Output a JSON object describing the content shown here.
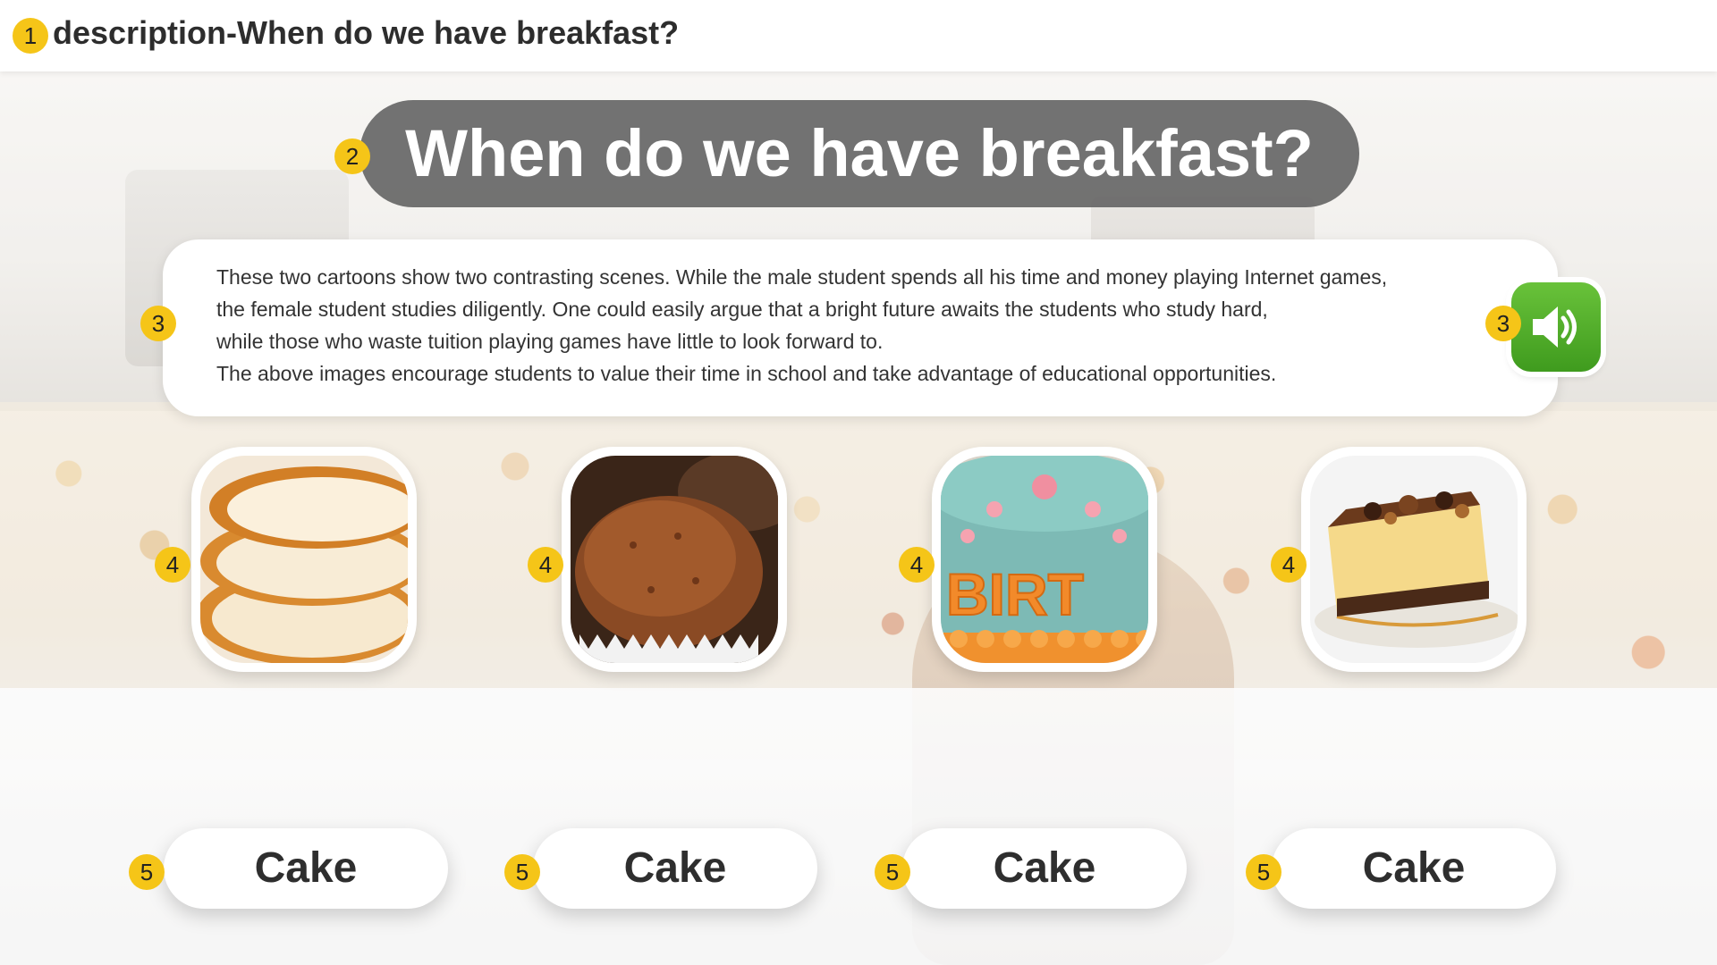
{
  "header": {
    "description": "description-When do we have breakfast?",
    "marker": "1"
  },
  "title": {
    "text": "When do we have breakfast?",
    "marker": "2"
  },
  "passage": {
    "marker": "3",
    "lines": [
      "These two cartoons show two contrasting scenes. While the male student spends all his time and money playing Internet games,",
      "the female student studies diligently. One could easily argue that a bright future awaits the students who study hard,",
      "while those who waste tuition playing games have little to look forward to.",
      "The above images encourage students to value their time in school and take advantage of educational opportunities."
    ]
  },
  "audio": {
    "marker": "3",
    "icon": "speaker-icon",
    "color": "#4caf23"
  },
  "pictures": [
    {
      "marker": "4",
      "icon": "bread-slices-image"
    },
    {
      "marker": "4",
      "icon": "muffin-image"
    },
    {
      "marker": "4",
      "icon": "birthday-cake-image",
      "cake_text": "BIRT"
    },
    {
      "marker": "4",
      "icon": "cheesecake-slice-image"
    }
  ],
  "answers": [
    {
      "marker": "5",
      "label": "Cake"
    },
    {
      "marker": "5",
      "label": "Cake"
    },
    {
      "marker": "5",
      "label": "Cake"
    },
    {
      "marker": "5",
      "label": "Cake"
    }
  ],
  "colors": {
    "marker": "#f5c518",
    "title_bg": "#606060",
    "audio_green": "#4caf23"
  }
}
